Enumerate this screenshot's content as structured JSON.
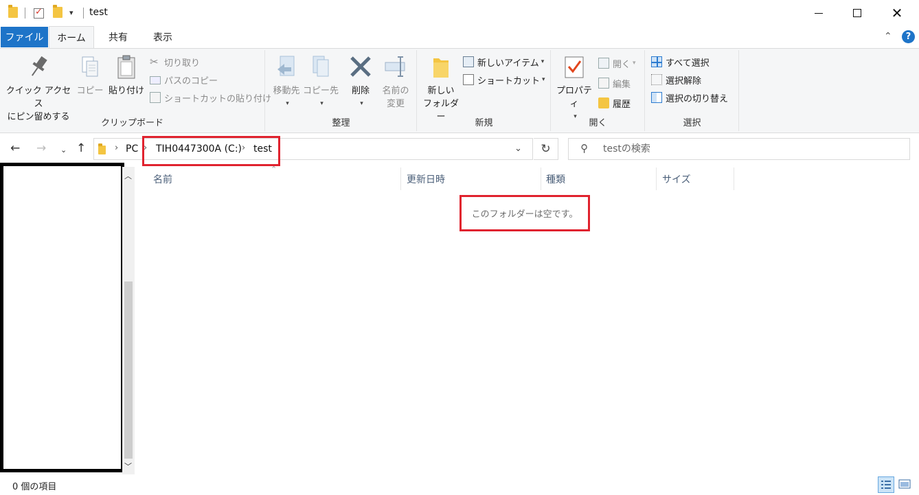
{
  "window": {
    "title": "test"
  },
  "tabs": {
    "file": "ファイル",
    "home": "ホーム",
    "share": "共有",
    "view": "表示"
  },
  "ribbon": {
    "clipboard": {
      "label": "クリップボード",
      "pin_line1": "クイック アクセス",
      "pin_line2": "にピン留めする",
      "copy": "コピー",
      "paste": "貼り付け",
      "cut": "切り取り",
      "copy_path": "パスのコピー",
      "paste_shortcut": "ショートカットの貼り付け"
    },
    "organize": {
      "label": "整理",
      "move_to": "移動先",
      "copy_to": "コピー先",
      "delete": "削除",
      "rename_line1": "名前の",
      "rename_line2": "変更"
    },
    "new": {
      "label": "新規",
      "new_folder_line1": "新しい",
      "new_folder_line2": "フォルダー",
      "new_item": "新しいアイテム",
      "shortcut": "ショートカット"
    },
    "open": {
      "label": "開く",
      "properties": "プロパティ",
      "open": "開く",
      "edit": "編集",
      "history": "履歴"
    },
    "select": {
      "label": "選択",
      "select_all": "すべて選択",
      "select_none": "選択解除",
      "invert": "選択の切り替え"
    }
  },
  "address": {
    "crumbs": [
      "PC",
      "TIH0447300A (C:)",
      "test"
    ]
  },
  "search": {
    "placeholder": "testの検索"
  },
  "columns": [
    "名前",
    "更新日時",
    "種類",
    "サイズ"
  ],
  "file_list": {
    "empty_message": "このフォルダーは空です。"
  },
  "status": {
    "item_count": "0 個の項目"
  },
  "colors": {
    "accent": "#1e74c8",
    "highlight": "#e0222e",
    "folder": "#f4c542"
  }
}
